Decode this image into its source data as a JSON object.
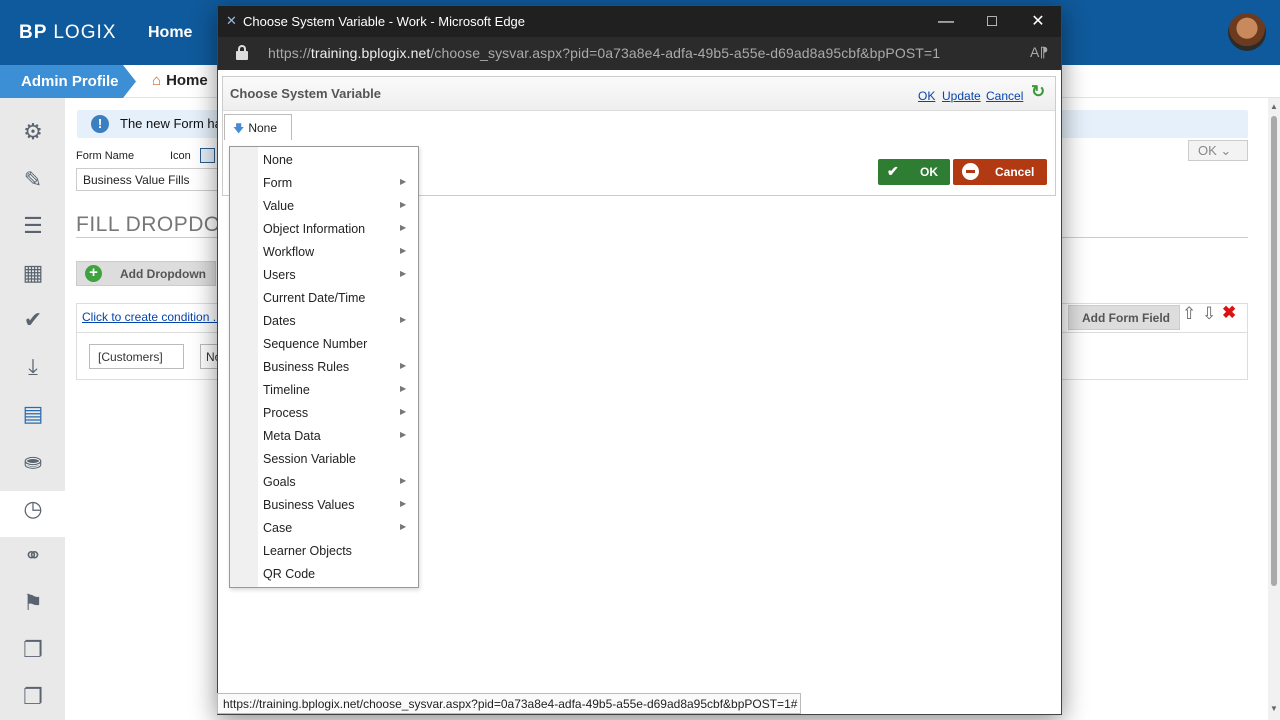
{
  "app": {
    "logo_main": "BP",
    "logo_rest": "LOGIX",
    "nav_home": "Home",
    "breadcrumb_admin": "Admin Profile",
    "breadcrumb_home": "Home"
  },
  "background": {
    "banner_text": "The new Form has b",
    "form_name_label": "Form Name",
    "icon_label": "Icon",
    "form_name_value": "Business Value Fills",
    "section_heading": "FILL DROPDOW",
    "add_dropdown_label": "Add Dropdown",
    "condition_link": "Click to create condition ...",
    "customers_value": "[Customers]",
    "no_value": "No",
    "add_form_field_label": "Add Form Field",
    "ok_dropdown_label": "OK"
  },
  "browser": {
    "window_title": "Choose System Variable - Work - Microsoft Edge",
    "url_prefix": "https://",
    "url_domain": "training.bplogix.net",
    "url_path": "/choose_sysvar.aspx?pid=0a73a8e4-adfa-49b5-a55e-d69ad8a95cbf&bpPOST=1",
    "status_url": "https://training.bplogix.net/choose_sysvar.aspx?pid=0a73a8e4-adfa-49b5-a55e-d69ad8a95cbf&bpPOST=1#"
  },
  "dialog": {
    "title": "Choose System Variable",
    "link_ok": "OK",
    "link_update": "Update",
    "link_cancel": "Cancel",
    "selected_value": "None",
    "btn_ok": "OK",
    "btn_cancel": "Cancel",
    "menu": [
      {
        "label": "None",
        "submenu": false
      },
      {
        "label": "Form",
        "submenu": true
      },
      {
        "label": "Value",
        "submenu": true
      },
      {
        "label": "Object Information",
        "submenu": true
      },
      {
        "label": "Workflow",
        "submenu": true
      },
      {
        "label": "Users",
        "submenu": true
      },
      {
        "label": "Current Date/Time",
        "submenu": false
      },
      {
        "label": "Dates",
        "submenu": true
      },
      {
        "label": "Sequence Number",
        "submenu": false
      },
      {
        "label": "Business Rules",
        "submenu": true
      },
      {
        "label": "Timeline",
        "submenu": true
      },
      {
        "label": "Process",
        "submenu": true
      },
      {
        "label": "Meta Data",
        "submenu": true
      },
      {
        "label": "Session Variable",
        "submenu": false
      },
      {
        "label": "Goals",
        "submenu": true
      },
      {
        "label": "Business Values",
        "submenu": true
      },
      {
        "label": "Case",
        "submenu": true
      },
      {
        "label": "Learner Objects",
        "submenu": false
      },
      {
        "label": "QR Code",
        "submenu": false
      }
    ]
  },
  "colors": {
    "topbar": "#0f5a9c",
    "admin_crumb": "#3c8fd4",
    "ok_button": "#2e7d32",
    "cancel_button": "#b23a12"
  },
  "icons": [
    "settings-gears-icon",
    "edit-icon",
    "list-icon",
    "table-icon",
    "check-icon",
    "download-icon",
    "form-icon",
    "database-add-icon",
    "dashboard-icon",
    "link-icon",
    "flag-icon",
    "copy-icon"
  ]
}
